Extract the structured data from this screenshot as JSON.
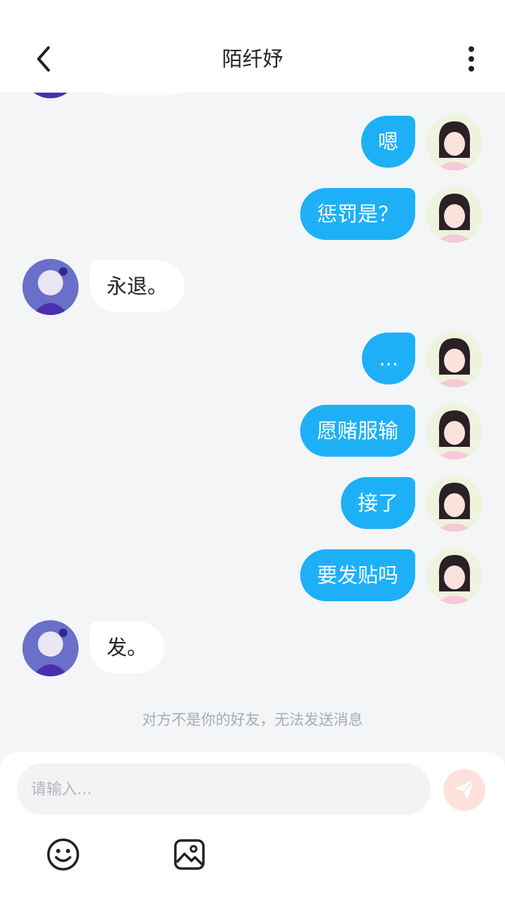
{
  "header": {
    "title": "陌纤妤",
    "back_icon": "chevron-left-icon",
    "more_icon": "more-vertical-icon"
  },
  "messages": [
    {
      "from": "me",
      "text": "嗯"
    },
    {
      "from": "me",
      "text": "惩罚是？"
    },
    {
      "from": "them",
      "text": "永退。"
    },
    {
      "from": "me",
      "text": "..."
    },
    {
      "from": "me",
      "text": "愿赌服输"
    },
    {
      "from": "me",
      "text": "接了"
    },
    {
      "from": "me",
      "text": "要发贴吗"
    },
    {
      "from": "them",
      "text": "发。"
    }
  ],
  "notice": "对方不是你的好友，无法发送消息",
  "composer": {
    "placeholder": "请输入...",
    "send_icon": "send-icon",
    "emoji_icon": "emoji-icon",
    "image_icon": "image-icon"
  },
  "colors": {
    "my_bubble": "#1eb0f7",
    "their_bubble": "#ffffff",
    "background": "#f3f5f7",
    "send_disabled": "#fde2dc"
  }
}
